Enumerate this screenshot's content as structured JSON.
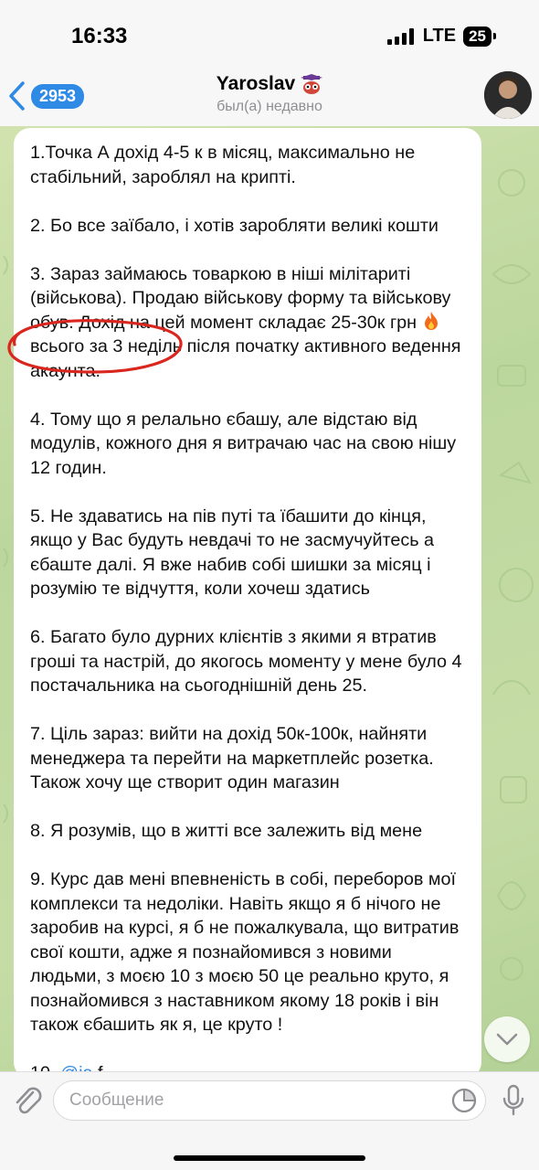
{
  "status_bar": {
    "time": "16:33",
    "network": "LTE",
    "battery": "25"
  },
  "header": {
    "unread_count": "2953",
    "chat_name": "Yaroslav",
    "chat_status": "был(а) недавно"
  },
  "message": {
    "paragraphs": [
      "1.Точка А дохід 4-5 к в місяц, максимально не стабільний, зароблял на крипті.",
      "2. Бо все заїбало, і хотів заробляти великі кошти",
      "3. Зараз займаюсь товаркою в ніші мілітариті (військова). Продаю військову форму та військову обув. Дохід на цей момент складає 25-30к грн",
      "4. Тому що я релально єбашу, але відстаю від модулів, кожного дня я витрачаю час на свою нішу 12 годин.",
      "5. Не здаватись на пів путі та їбашити до кінця, якщо у Вас будуть невдачі то не засмучуйтесь а єбаште далі. Я вже набив собі шишки за місяц і розумію те відчуття, коли хочеш здатись",
      "6. Багато було дурних клієнтів з якими я втратив гроші та настрій, до якогось моменту у мене було 4 постачальника на сьогоднішній день 25.",
      "7. Ціль зараз: вийти на дохід 50к-100к, найняти менеджера та перейти на маркетплейс розетка. Також хочу ще створит один магазин",
      "8. Я розумів, що в житті все залежить від мене",
      "9. Курс дав мені впевненість в собі, переборов мої комплекси та недоліки. Навіть якщо я б нічого не заробив на курсі, я б не пожалкувала, що витратив свої кошти, адже я познайомився з новими людьми, з моєю 10 з моєю 50 це реально круто, я познайомився з наставником якому 18 років і він також єбашить як я, це круто !"
    ],
    "p3_tail": "всього за 3 неділь після початку активного ведення акаунта.",
    "next_para_prefix": "10.",
    "next_para_link": "@ia",
    "next_para_rest": "f"
  },
  "input": {
    "placeholder": "Сообщение",
    "value": ""
  },
  "icons": {
    "back": "chevron-left-icon",
    "attach": "paperclip-icon",
    "sticker": "sticker-icon",
    "mic": "microphone-icon",
    "scroll": "chevron-down-icon",
    "fire": "fire-emoji-icon",
    "name_emoji": "graduation-owl-emoji-icon"
  },
  "colors": {
    "accent": "#2f8ae5",
    "annotation": "#d9271f",
    "bubble": "#ffffff"
  }
}
